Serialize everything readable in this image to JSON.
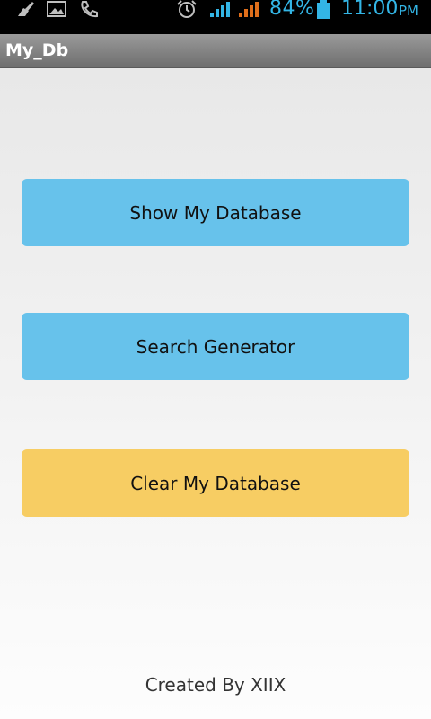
{
  "status_bar": {
    "icons": [
      "broom-icon",
      "image-icon",
      "phone-icon",
      "alarm-clock-icon",
      "signal-icon",
      "signal-roaming-icon",
      "battery-icon"
    ],
    "battery_percent": "84%",
    "time": "11:00",
    "ampm": "PM",
    "accent_color": "#33b5e5"
  },
  "action_bar": {
    "title": "My_Db"
  },
  "buttons": {
    "show_db": "Show My Database",
    "search_generator": "Search Generator",
    "clear_db": "Clear My Database"
  },
  "colors": {
    "primary_button": "#67c2eb",
    "warning_button": "#f7cd63"
  },
  "footer": {
    "credit": "Created By XIIX"
  }
}
